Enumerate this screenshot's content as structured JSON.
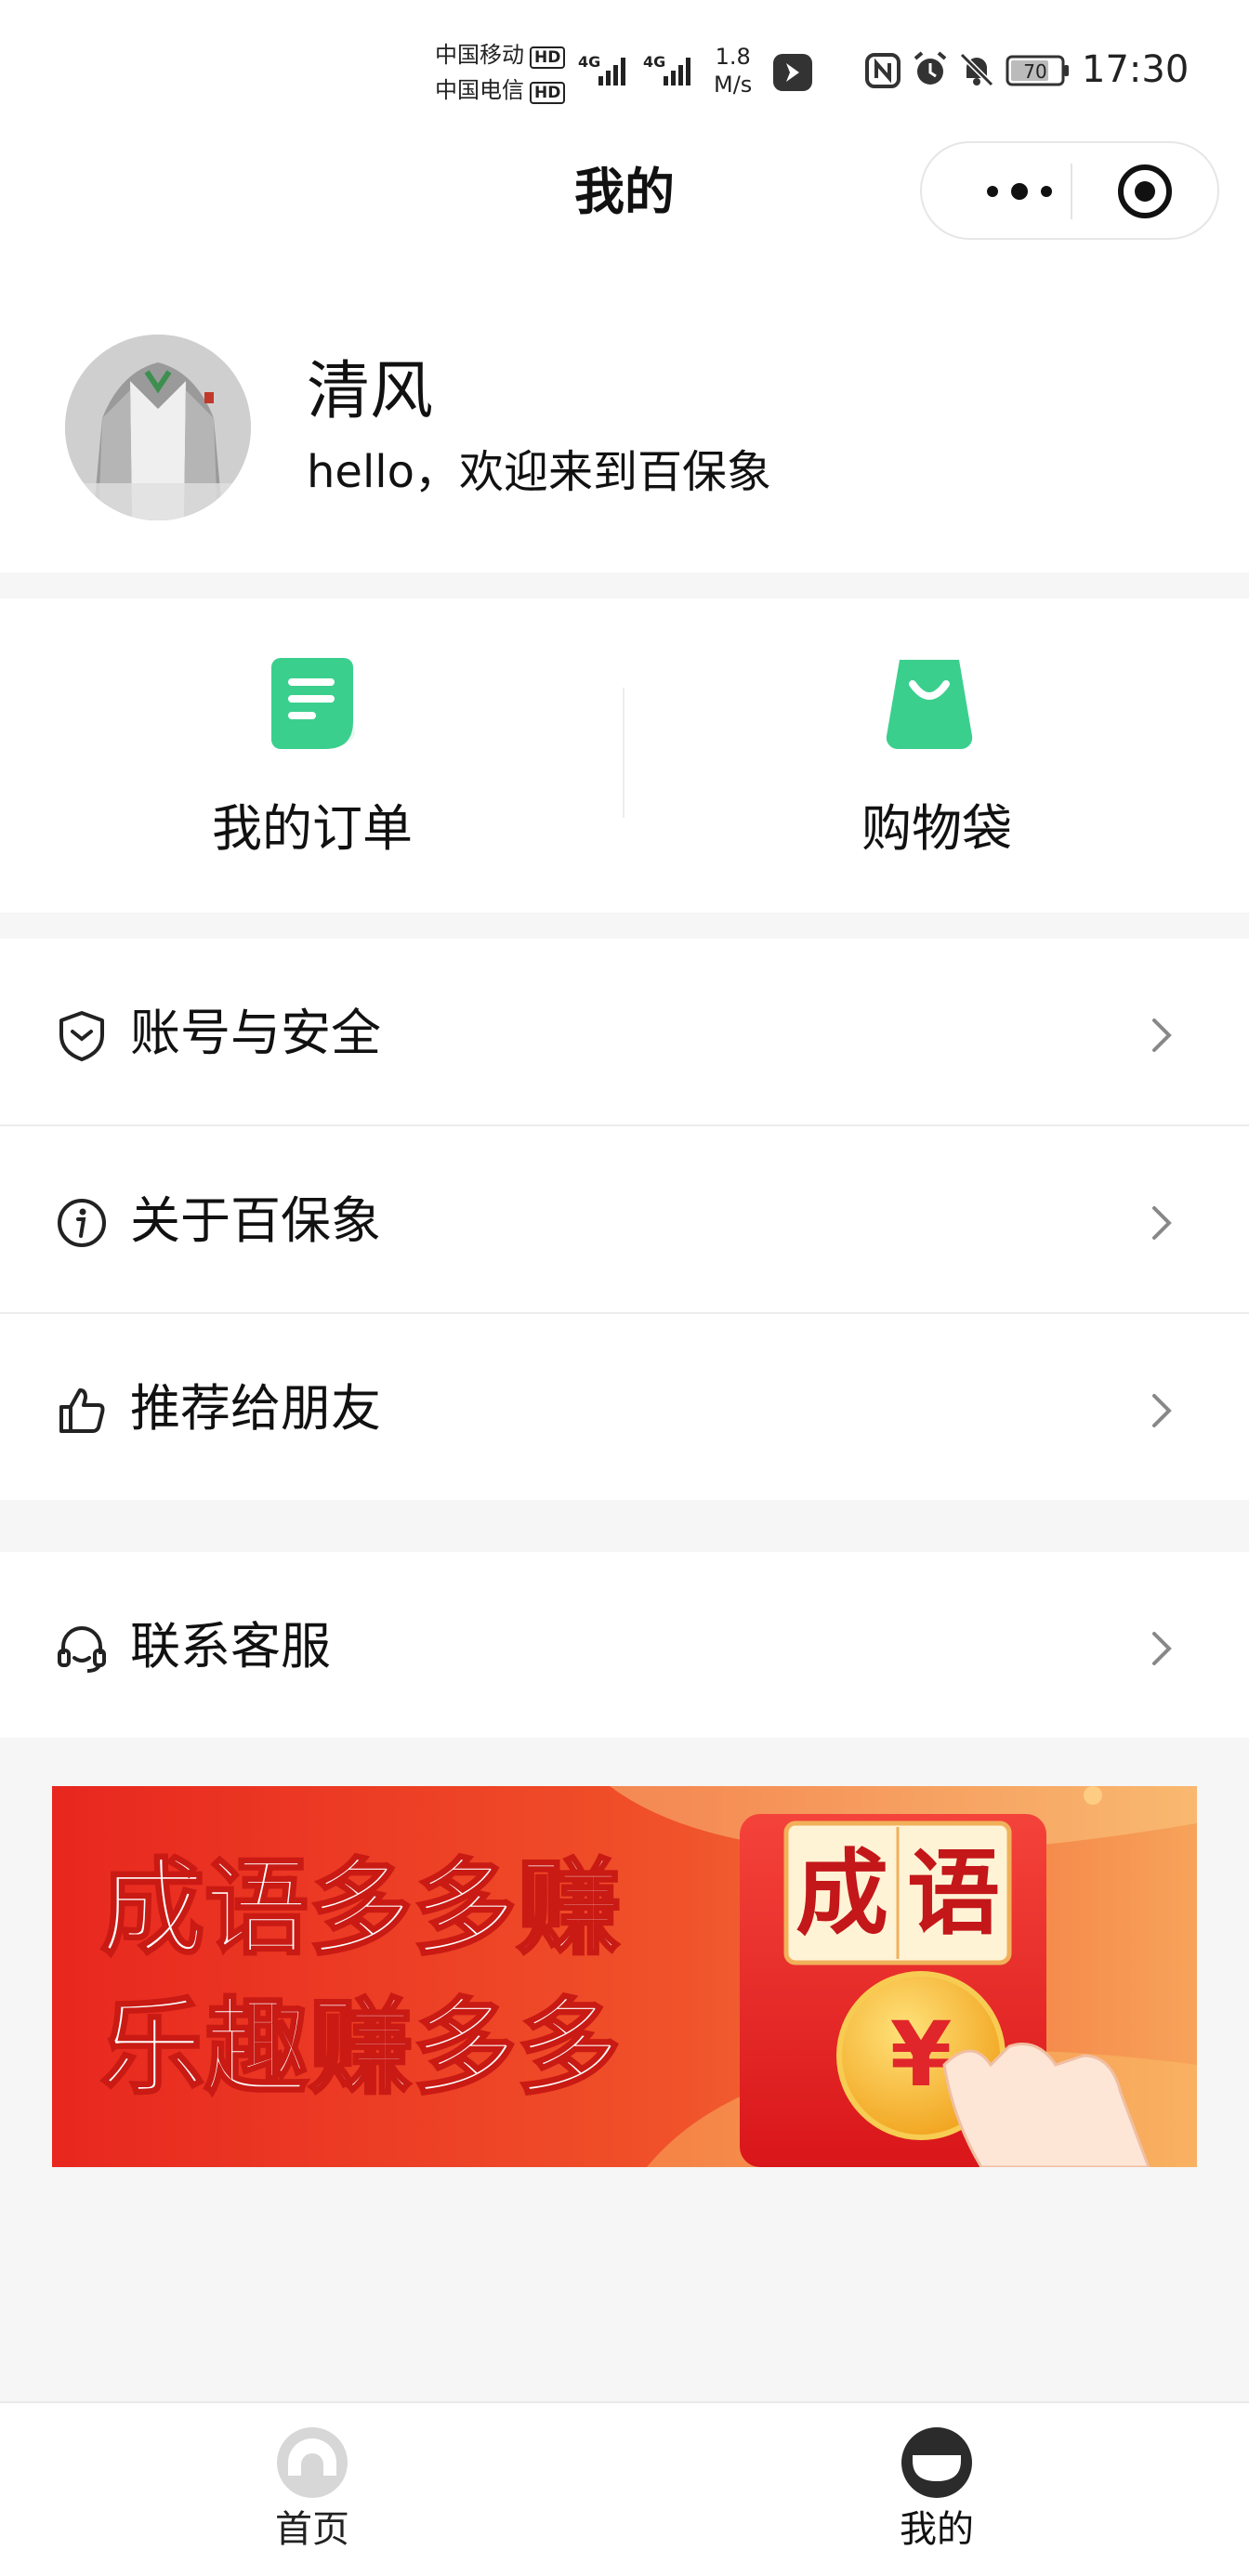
{
  "status_bar": {
    "carrier1": "中国移动",
    "carrier2": "中国电信",
    "hd": "HD",
    "net1": "4G",
    "net2": "4G",
    "speed_value": "1.8",
    "speed_unit": "M/s",
    "battery": "70",
    "time": "17:30"
  },
  "nav": {
    "title": "我的"
  },
  "profile": {
    "name": "清风",
    "greeting": "hello，欢迎来到百保象"
  },
  "quick_actions": [
    {
      "label": "我的订单",
      "icon": "order-list-icon"
    },
    {
      "label": "购物袋",
      "icon": "shopping-bag-icon"
    }
  ],
  "menu": [
    {
      "label": "账号与安全",
      "icon": "shield-icon"
    },
    {
      "label": "关于百保象",
      "icon": "info-icon"
    },
    {
      "label": "推荐给朋友",
      "icon": "thumbs-up-icon"
    },
    {
      "label": "联系客服",
      "icon": "headset-icon"
    }
  ],
  "banner": {
    "line1": "成语多多赚",
    "line2": "乐趣赚多多",
    "envelope_text1": "成",
    "envelope_text2": "语",
    "coin_symbol": "¥",
    "colors": {
      "red": "#e8271f",
      "orange": "#f57a2a",
      "gold": "#f6c242"
    }
  },
  "tabbar": [
    {
      "label": "首页",
      "icon": "home-icon",
      "active": false
    },
    {
      "label": "我的",
      "icon": "profile-icon",
      "active": true
    }
  ],
  "colors": {
    "accent_green": "#3bcf8e",
    "background": "#f6f6f6"
  }
}
